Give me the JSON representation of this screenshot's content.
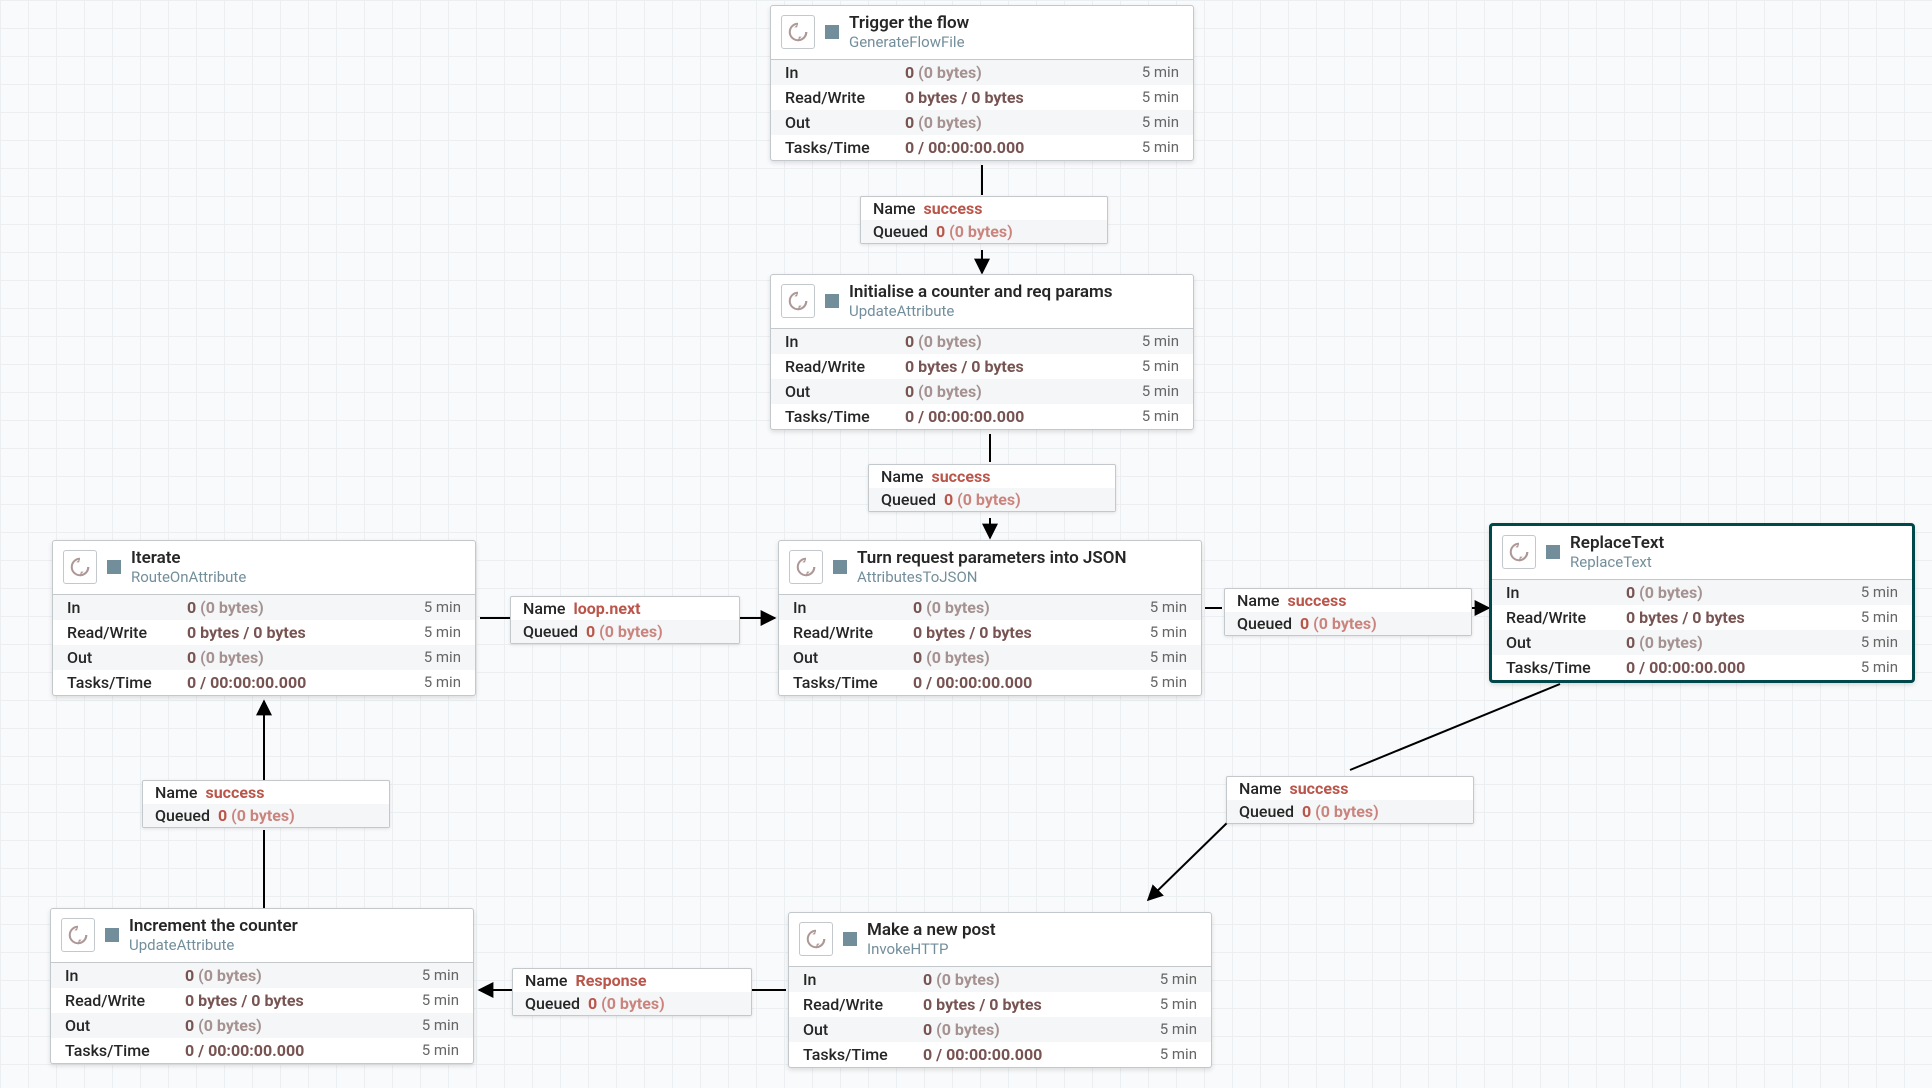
{
  "labels": {
    "in": "In",
    "rw": "Read/Write",
    "out": "Out",
    "tasks": "Tasks/Time",
    "name": "Name",
    "queued": "Queued",
    "time": "5 min"
  },
  "stat_defaults": {
    "count": "0",
    "count_suffix": " (0 bytes)",
    "rw": "0 bytes / 0 bytes",
    "tasks": "0 / 00:00:00.000"
  },
  "processors": {
    "p1": {
      "title": "Trigger the flow",
      "type": "GenerateFlowFile"
    },
    "p2": {
      "title": "Initialise a counter and req params",
      "type": "UpdateAttribute"
    },
    "p3": {
      "title": "Turn request parameters into JSON",
      "type": "AttributesToJSON"
    },
    "p4": {
      "title": "Iterate",
      "type": "RouteOnAttribute"
    },
    "p5": {
      "title": "ReplaceText",
      "type": "ReplaceText"
    },
    "p6": {
      "title": "Make a new post",
      "type": "InvokeHTTP"
    },
    "p7": {
      "title": "Increment the counter",
      "type": "UpdateAttribute"
    }
  },
  "connections": {
    "c1": {
      "name": "success",
      "queued": "0",
      "queued_suffix": " (0 bytes)"
    },
    "c2": {
      "name": "success",
      "queued": "0",
      "queued_suffix": " (0 bytes)"
    },
    "c3": {
      "name": "loop.next",
      "queued": "0",
      "queued_suffix": " (0 bytes)"
    },
    "c4": {
      "name": "success",
      "queued": "0",
      "queued_suffix": " (0 bytes)"
    },
    "c5": {
      "name": "success",
      "queued": "0",
      "queued_suffix": " (0 bytes)"
    },
    "c6": {
      "name": "Response",
      "queued": "0",
      "queued_suffix": " (0 bytes)"
    },
    "c7": {
      "name": "success",
      "queued": "0",
      "queued_suffix": " (0 bytes)"
    }
  }
}
